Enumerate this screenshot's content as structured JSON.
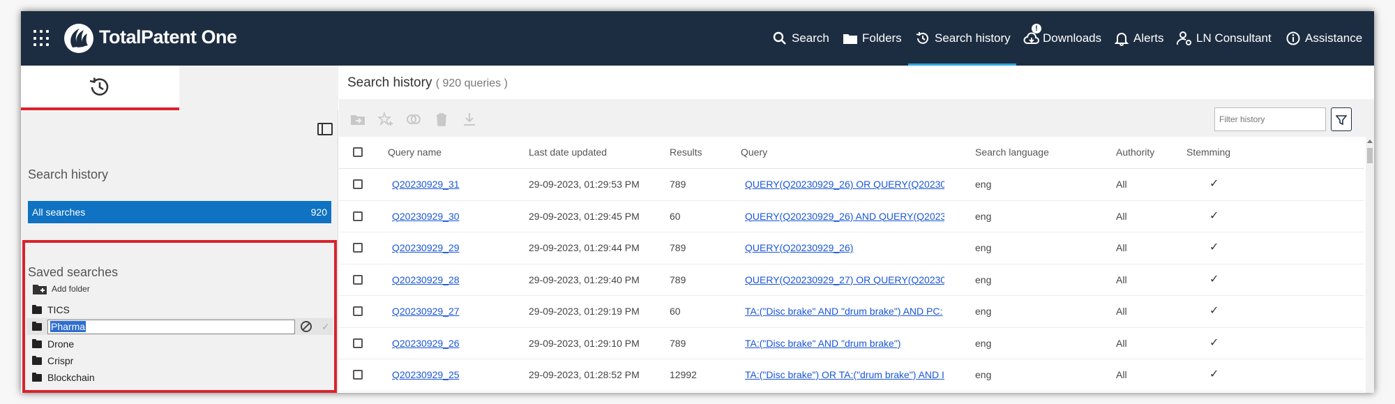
{
  "header": {
    "brand": "TotalPatent One",
    "nav": [
      {
        "label": "Search",
        "icon": "search-icon"
      },
      {
        "label": "Folders",
        "icon": "folder-icon"
      },
      {
        "label": "Search history",
        "icon": "history-icon",
        "active": true
      },
      {
        "label": "Downloads",
        "icon": "cloud-download-icon",
        "badge": "!"
      },
      {
        "label": "Alerts",
        "icon": "bell-icon"
      },
      {
        "label": "LN Consultant",
        "icon": "user-gear-icon"
      },
      {
        "label": "Assistance",
        "icon": "info-icon"
      }
    ]
  },
  "sidebar": {
    "history_heading": "Search history",
    "all_searches": {
      "label": "All searches",
      "count": "920"
    },
    "saved_heading": "Saved searches",
    "add_folder": "Add folder",
    "folders": [
      "TICS",
      "Pharma",
      "Drone",
      "Crispr",
      "Blockchain"
    ],
    "editing_value": "Pharma"
  },
  "main": {
    "title": "Search history",
    "count": "( 920 queries )",
    "filter_placeholder": "Filter history",
    "columns": [
      "Query name",
      "Last date updated",
      "Results",
      "Query",
      "Search language",
      "Authority",
      "Stemming"
    ],
    "rows": [
      {
        "name": "Q20230929_31",
        "date": "29-09-2023, 01:29:53 PM",
        "results": "789",
        "query": "QUERY(Q20230929_26) OR QUERY(Q20230",
        "lang": "eng",
        "authority": "All",
        "stemming": "✓"
      },
      {
        "name": "Q20230929_30",
        "date": "29-09-2023, 01:29:45 PM",
        "results": "60",
        "query": "QUERY(Q20230929_26) AND QUERY(Q2023",
        "lang": "eng",
        "authority": "All",
        "stemming": "✓"
      },
      {
        "name": "Q20230929_29",
        "date": "29-09-2023, 01:29:44 PM",
        "results": "789",
        "query": "QUERY(Q20230929_26)",
        "lang": "eng",
        "authority": "All",
        "stemming": "✓"
      },
      {
        "name": "Q20230929_28",
        "date": "29-09-2023, 01:29:40 PM",
        "results": "789",
        "query": "QUERY(Q20230929_27) OR QUERY(Q20230",
        "lang": "eng",
        "authority": "All",
        "stemming": "✓"
      },
      {
        "name": "Q20230929_27",
        "date": "29-09-2023, 01:29:19 PM",
        "results": "60",
        "query": "TA:(\"Disc brake\" AND \"drum brake\") AND PC:",
        "lang": "eng",
        "authority": "All",
        "stemming": "✓"
      },
      {
        "name": "Q20230929_26",
        "date": "29-09-2023, 01:29:10 PM",
        "results": "789",
        "query": "TA:(\"Disc brake\" AND \"drum brake\")",
        "lang": "eng",
        "authority": "All",
        "stemming": "✓"
      },
      {
        "name": "Q20230929_25",
        "date": "29-09-2023, 01:28:52 PM",
        "results": "12992",
        "query": "TA:(\"Disc brake\") OR TA:(\"drum brake\") AND I",
        "lang": "eng",
        "authority": "All",
        "stemming": "✓"
      }
    ]
  },
  "colors": {
    "header_bg": "#1d2d41",
    "accent_blue": "#0f72c2",
    "highlight_red": "#d9232d",
    "link": "#1a56d8"
  }
}
